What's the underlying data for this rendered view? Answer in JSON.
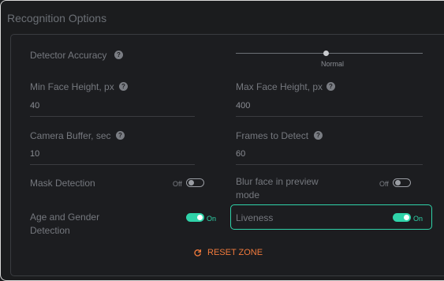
{
  "section": {
    "title": "Recognition Options"
  },
  "detector_accuracy": {
    "label": "Detector Accuracy",
    "slider_label": "Normal"
  },
  "min_face_height": {
    "label": "Min Face Height, px",
    "value": "40"
  },
  "max_face_height": {
    "label": "Max Face Height, px",
    "value": "400"
  },
  "camera_buffer": {
    "label": "Camera Buffer, sec",
    "value": "10"
  },
  "frames_to_detect": {
    "label": "Frames to Detect",
    "value": "60"
  },
  "mask_detection": {
    "label": "Mask Detection",
    "state": "Off"
  },
  "blur_face": {
    "label_line1": "Blur face in preview",
    "label_line2": "mode",
    "state": "Off"
  },
  "age_gender": {
    "label_line1": "Age and Gender",
    "label_line2": "Detection",
    "state": "On"
  },
  "liveness": {
    "label": "Liveness",
    "state": "On"
  },
  "reset": {
    "label": "RESET ZONE"
  },
  "help_glyph": "?",
  "colors": {
    "accent": "#2fd3a9",
    "reset": "#f07a3c",
    "border": "#d9d9d9"
  }
}
